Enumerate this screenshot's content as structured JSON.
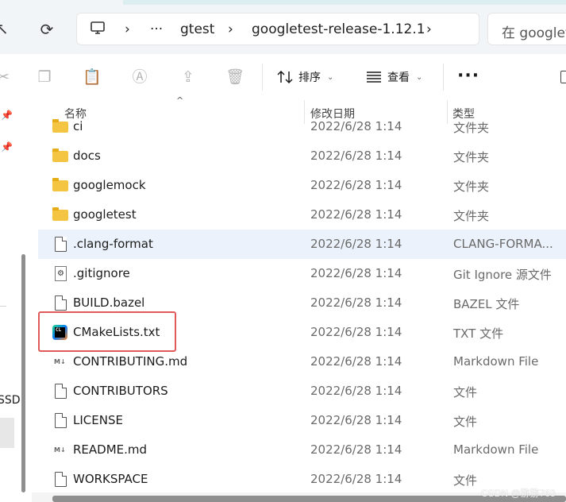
{
  "address": {
    "computer_icon": "computer-icon",
    "ellipsis": "···",
    "crumbs": [
      "gtest",
      "googletest-release-1.12.1"
    ],
    "search_placeholder": "在 googlet"
  },
  "toolbar": {
    "sort_label": "排序",
    "view_label": "查看",
    "more_label": "···"
  },
  "sidebar": {
    "drive_label": "SSD"
  },
  "columns": {
    "name": "名称",
    "modified": "修改日期",
    "type": "类型"
  },
  "files": [
    {
      "name": "ci",
      "modified": "2022/6/28 1:14",
      "type": "文件夹",
      "icon": "folder-icon"
    },
    {
      "name": "docs",
      "modified": "2022/6/28 1:14",
      "type": "文件夹",
      "icon": "folder-icon"
    },
    {
      "name": "googlemock",
      "modified": "2022/6/28 1:14",
      "type": "文件夹",
      "icon": "folder-icon"
    },
    {
      "name": "googletest",
      "modified": "2022/6/28 1:14",
      "type": "文件夹",
      "icon": "folder-icon"
    },
    {
      "name": ".clang-format",
      "modified": "2022/6/28 1:14",
      "type": "CLANG-FORMA...",
      "icon": "file-icon"
    },
    {
      "name": ".gitignore",
      "modified": "2022/6/28 1:14",
      "type": "Git Ignore 源文件",
      "icon": "settings-file-icon"
    },
    {
      "name": "BUILD.bazel",
      "modified": "2022/6/28 1:14",
      "type": "BAZEL 文件",
      "icon": "file-icon"
    },
    {
      "name": "CMakeLists.txt",
      "modified": "2022/6/28 1:14",
      "type": "TXT 文件",
      "icon": "clion-icon"
    },
    {
      "name": "CONTRIBUTING.md",
      "modified": "2022/6/28 1:14",
      "type": "Markdown File",
      "icon": "markdown-icon"
    },
    {
      "name": "CONTRIBUTORS",
      "modified": "2022/6/28 1:14",
      "type": "文件",
      "icon": "file-icon"
    },
    {
      "name": "LICENSE",
      "modified": "2022/6/28 1:14",
      "type": "文件",
      "icon": "file-icon"
    },
    {
      "name": "README.md",
      "modified": "2022/6/28 1:14",
      "type": "Markdown File",
      "icon": "markdown-icon"
    },
    {
      "name": "WORKSPACE",
      "modified": "2022/6/28 1:14",
      "type": "文件",
      "icon": "file-icon"
    }
  ],
  "watermark": "CSDN @猕猕763",
  "colors": {
    "selection": "#ebf2fb",
    "highlight_border": "#e05a5a",
    "folder": "#f4c542"
  }
}
